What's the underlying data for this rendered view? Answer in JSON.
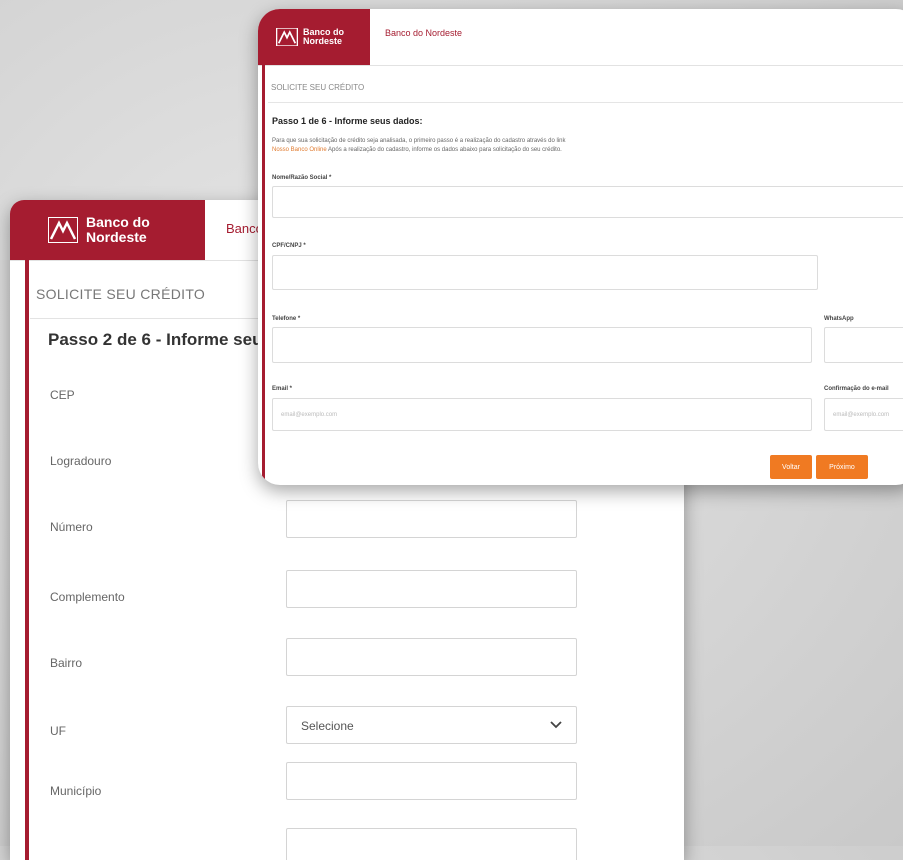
{
  "brand": {
    "name_line1": "Banco do",
    "name_line2": "Nordeste",
    "color": "#a51c30",
    "accent_orange": "#f07a22"
  },
  "back_window": {
    "nav_label": "Banco",
    "section_title": "SOLICITE SEU CRÉDITO",
    "step_title": "Passo 2 de 6 - Informe seu",
    "fields": {
      "cep": "CEP",
      "logradouro": "Logradouro",
      "numero": "Número",
      "complemento": "Complemento",
      "bairro": "Bairro",
      "uf": "UF",
      "municipio": "Município"
    },
    "uf_select_value": "Selecione"
  },
  "front_window": {
    "nav_label": "Banco do Nordeste",
    "section_title": "SOLICITE SEU CRÉDITO",
    "step_title": "Passo 1 de 6 - Informe seus dados:",
    "intro_line1": "Para que sua solicitação de crédito seja analisada, o primeiro passo é a realização do cadastro através do link",
    "intro_link": "Nosso Banco Online",
    "intro_line2": "Após a realização do cadastro, informe os dados abaixo para solicitação do seu crédito.",
    "fields": {
      "nome": "Nome/Razão Social *",
      "cpf": "CPF/CNPJ *",
      "telefone": "Telefone *",
      "whatsapp": "WhatsApp",
      "email": "Email *",
      "email_confirm": "Confirmação do e-mail"
    },
    "placeholders": {
      "email": "email@exemplo.com",
      "email_confirm": "email@exemplo.com"
    },
    "buttons": {
      "back": "Voltar",
      "next": "Próximo"
    }
  }
}
